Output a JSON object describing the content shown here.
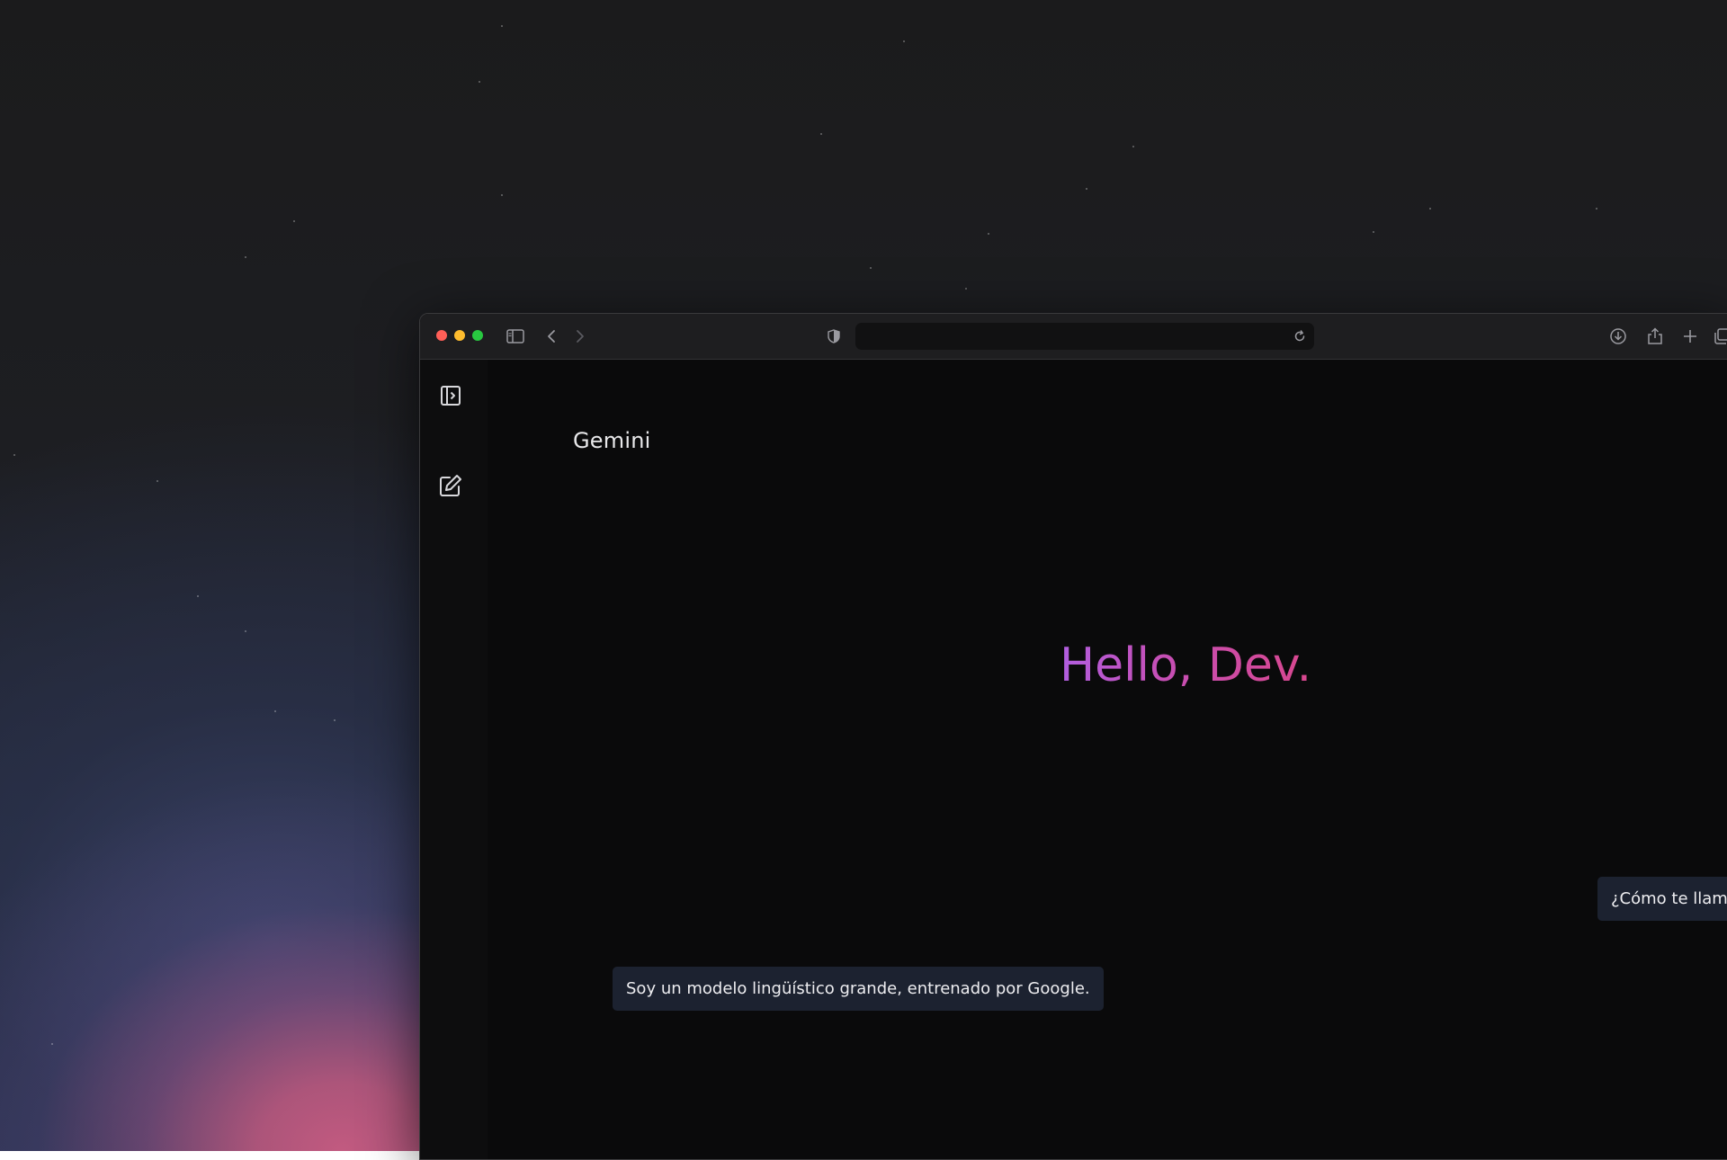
{
  "app": {
    "title": "Gemini"
  },
  "main": {
    "greeting": "Hello, Dev.",
    "messages": [
      {
        "role": "user",
        "text": "¿Cómo te llamas?"
      },
      {
        "role": "assistant",
        "text": "Soy un modelo lingüístico grande, entrenado por Google."
      }
    ]
  },
  "browser": {
    "address_value": "",
    "toolbar_icons": [
      "sidebar-toggle-icon",
      "back-icon",
      "forward-icon",
      "privacy-shield-icon",
      "reload-icon",
      "download-icon",
      "share-icon",
      "new-tab-icon",
      "tab-overview-icon"
    ]
  },
  "sidebar": {
    "icons": [
      "expand-sidebar-icon",
      "new-chat-icon"
    ]
  },
  "colors": {
    "greeting_gradient_start": "#b15ee0",
    "greeting_gradient_end": "#d9478e",
    "bubble_bg": "#1c2230",
    "traffic_close": "#ff5f57",
    "traffic_minimize": "#febc2e",
    "traffic_maximize": "#28c840"
  }
}
